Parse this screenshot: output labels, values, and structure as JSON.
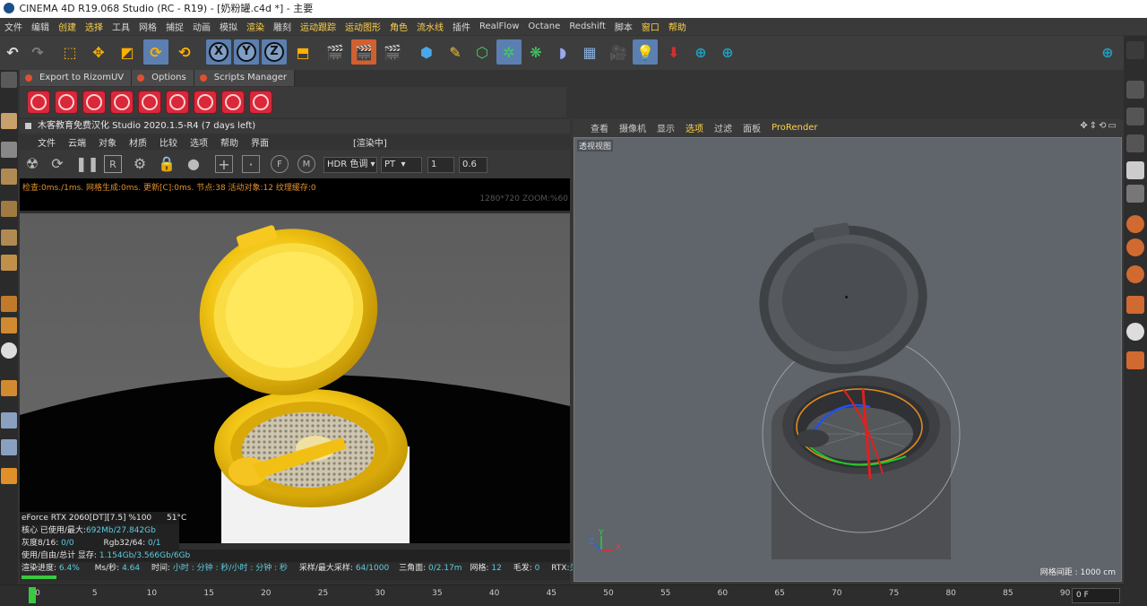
{
  "window": {
    "title": "CINEMA 4D R19.068 Studio (RC - R19) - [奶粉罐.c4d *] - 主要"
  },
  "menubar": {
    "items": [
      {
        "label": "文件",
        "hl": false
      },
      {
        "label": "编辑",
        "hl": false
      },
      {
        "label": "创建",
        "hl": true
      },
      {
        "label": "选择",
        "hl": true
      },
      {
        "label": "工具",
        "hl": false
      },
      {
        "label": "网格",
        "hl": false
      },
      {
        "label": "捕捉",
        "hl": false
      },
      {
        "label": "动画",
        "hl": false
      },
      {
        "label": "模拟",
        "hl": false
      },
      {
        "label": "渲染",
        "hl": true
      },
      {
        "label": "雕刻",
        "hl": false
      },
      {
        "label": "运动跟踪",
        "hl": true
      },
      {
        "label": "运动图形",
        "hl": true
      },
      {
        "label": "角色",
        "hl": true
      },
      {
        "label": "流水线",
        "hl": true
      },
      {
        "label": "插件",
        "hl": false
      },
      {
        "label": "RealFlow",
        "hl": false
      },
      {
        "label": "Octane",
        "hl": false
      },
      {
        "label": "Redshift",
        "hl": false
      },
      {
        "label": "脚本",
        "hl": false
      },
      {
        "label": "窗口",
        "hl": true
      },
      {
        "label": "帮助",
        "hl": true
      }
    ]
  },
  "toolbar": {
    "axis_x": "X",
    "axis_y": "Y",
    "axis_z": "Z"
  },
  "plugin_tabs": [
    "Export to RizomUV",
    "Options",
    "Scripts Manager"
  ],
  "plugin_buttons": [
    "btn1",
    "btn2",
    "btn3",
    "btn4",
    "btn5",
    "btn6",
    "btn7",
    "btn8",
    "btn9"
  ],
  "render_panel": {
    "title": "木客教育免费汉化 Studio 2020.1.5-R4 (7 days left)",
    "menu": [
      "文件",
      "云端",
      "对象",
      "材质",
      "比较",
      "选项",
      "帮助",
      "界面"
    ],
    "status_tag": "[渲染中]",
    "hdr_select": "HDR 色调",
    "mode_select": "PT",
    "spin1": "1",
    "spin2": "0.6",
    "status_line": "检查:0ms./1ms. 网格生成:0ms. 更新[C]:0ms. 节点:38 活动对象:12 纹理缓存:0",
    "resolution": "1280*720 ZOOM:%60",
    "gpu_label": "eForce RTX 2060[DT][7.5]  %100",
    "gpu_temp": "51°C",
    "core_label": "核心 已使用/最大:",
    "core_value": "692Mb/27.842Gb",
    "gray_label": "灰度8/16:",
    "gray_value": "0/0",
    "rgb_label": "Rgb32/64:",
    "rgb_value": "0/1",
    "mem_label": "使用/自由/总计 显存:",
    "mem_value": "1.154Gb/3.566Gb/6Gb",
    "progress_label": "渲染进度:",
    "progress_value": "6.4%",
    "mss_label": "Ms/秒:",
    "mss_value": "4.64",
    "time_label": "时间:",
    "time_value": "小时 : 分钟 : 秒/小时 : 分钟 : 秒",
    "sample_label": "采样/最大采样:",
    "sample_value": "64/1000",
    "tri_label": "三角面:",
    "tri_value": "0/2.17m",
    "mesh_label": "网格:",
    "mesh_value": "12",
    "hair_label": "毛发:",
    "hair_value": "0",
    "rtx_label": "RTX:",
    "rtx_value": "关",
    "progress_fraction": 0.064
  },
  "viewport": {
    "menu": [
      "查看",
      "摄像机",
      "显示",
      "选项",
      "过滤",
      "面板",
      "ProRender"
    ],
    "menu_hl": [
      false,
      false,
      false,
      true,
      false,
      false,
      true
    ],
    "label": "透视视图",
    "grid": "网格间距 : 1000 cm",
    "axis_x": "X",
    "axis_y": "Y",
    "axis_z": "Z"
  },
  "timeline": {
    "ticks": [
      "0",
      "5",
      "10",
      "15",
      "20",
      "25",
      "30",
      "35",
      "40",
      "45",
      "50",
      "55",
      "60",
      "65",
      "70",
      "75",
      "80",
      "85",
      "90"
    ],
    "frame": "0 F"
  }
}
